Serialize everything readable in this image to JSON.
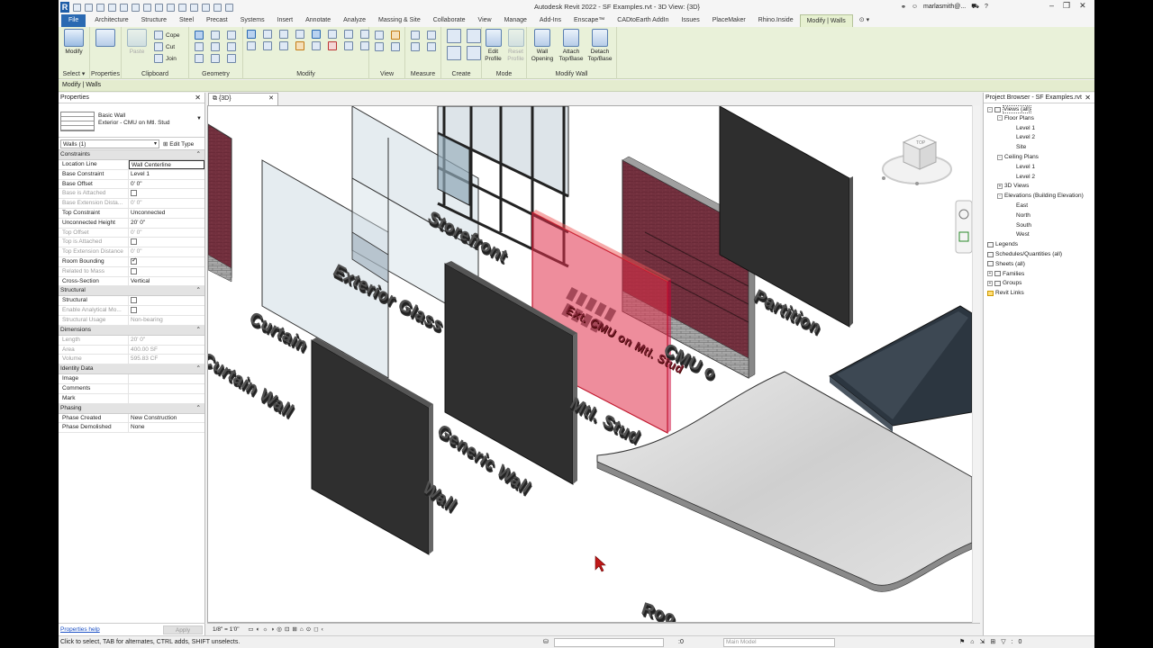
{
  "title_bar": {
    "title": "Autodesk Revit 2022 - SF Examples.rvt - 3D View: {3D}",
    "user": "marlasmith@...",
    "logo_letter": "R"
  },
  "ribbon_tabs": [
    "File",
    "Architecture",
    "Structure",
    "Steel",
    "Precast",
    "Systems",
    "Insert",
    "Annotate",
    "Analyze",
    "Massing & Site",
    "Collaborate",
    "View",
    "Manage",
    "Add-Ins",
    "Enscape™",
    "CADtoEarth AddIn",
    "Issues",
    "PlaceMaker",
    "Rhino.Inside",
    "Modify | Walls"
  ],
  "ribbon": {
    "modify_label": "Modify",
    "select_label": "Select ▾",
    "properties_label": "Properties",
    "paste_label": "Paste",
    "clipboard_label": "Clipboard",
    "cope_label": "Cope",
    "cut_label": "Cut",
    "join_label": "Join",
    "geometry_label": "Geometry",
    "modify_panel_label": "Modify",
    "view_label": "View",
    "measure_label": "Measure",
    "create_label": "Create",
    "edit_profile_label": "Edit Profile",
    "reset_profile_label": "Reset Profile",
    "mode_label": "Mode",
    "wall_opening_label": "Wall Opening",
    "attach_label": "Attach Top/Base",
    "detach_label": "Detach Top/Base",
    "modify_wall_label": "Modify Wall"
  },
  "context_bar": {
    "text": "Modify | Walls"
  },
  "properties": {
    "header": "Properties",
    "type_family": "Basic Wall",
    "type_name": "Exterior - CMU on Mtl. Stud",
    "instance_filter": "Walls (1)",
    "edit_type": "Edit Type",
    "groups": [
      {
        "name": "Constraints",
        "rows": [
          {
            "k": "Location Line",
            "v": "Wall Centerline",
            "boxed": true
          },
          {
            "k": "Base Constraint",
            "v": "Level 1"
          },
          {
            "k": "Base Offset",
            "v": "0'  0\""
          },
          {
            "k": "Base is Attached",
            "v": "",
            "dis": true,
            "cb": "off"
          },
          {
            "k": "Base Extension Dista...",
            "v": "0'  0\"",
            "dis": true
          },
          {
            "k": "Top Constraint",
            "v": "Unconnected"
          },
          {
            "k": "Unconnected Height",
            "v": "20'  0\""
          },
          {
            "k": "Top Offset",
            "v": "0'  0\"",
            "dis": true
          },
          {
            "k": "Top is Attached",
            "v": "",
            "dis": true,
            "cb": "off"
          },
          {
            "k": "Top Extension Distance",
            "v": "0'  0\"",
            "dis": true
          },
          {
            "k": "Room Bounding",
            "v": "",
            "cb": "on"
          },
          {
            "k": "Related to Mass",
            "v": "",
            "dis": true,
            "cb": "off"
          },
          {
            "k": "Cross-Section",
            "v": "Vertical"
          }
        ]
      },
      {
        "name": "Structural",
        "rows": [
          {
            "k": "Structural",
            "v": "",
            "cb": "off"
          },
          {
            "k": "Enable Analytical Mo...",
            "v": "",
            "dis": true,
            "cb": "off"
          },
          {
            "k": "Structural Usage",
            "v": "Non-bearing",
            "dis": true
          }
        ]
      },
      {
        "name": "Dimensions",
        "rows": [
          {
            "k": "Length",
            "v": "20'  0\"",
            "dis": true
          },
          {
            "k": "Area",
            "v": "400.00 SF",
            "dis": true
          },
          {
            "k": "Volume",
            "v": "595.83 CF",
            "dis": true
          }
        ]
      },
      {
        "name": "Identity Data",
        "rows": [
          {
            "k": "Image",
            "v": ""
          },
          {
            "k": "Comments",
            "v": ""
          },
          {
            "k": "Mark",
            "v": ""
          }
        ]
      },
      {
        "name": "Phasing",
        "rows": [
          {
            "k": "Phase Created",
            "v": "New Construction"
          },
          {
            "k": "Phase Demolished",
            "v": "None"
          }
        ]
      }
    ],
    "help_link": "Properties help",
    "apply": "Apply"
  },
  "view": {
    "tab_label": "{3D}",
    "scale": "1/8\" = 1'0\"",
    "labels": {
      "storefront": "Storefront",
      "exterior_glass": "Exterior Glass",
      "curtain": "Curtain",
      "curtain_wall": "Curtain Wall",
      "generic_wall": "Generic Wall",
      "wall": "Wall",
      "cmu": "CMU o",
      "partition": "Partition",
      "mtl_stud": "Mtl. Stud",
      "roof": "Roo",
      "red_text": "Ext. CMU on Mtl. Stud"
    }
  },
  "project_browser": {
    "header": "Project Browser - SF Examples.rvt",
    "tree": [
      {
        "label": "Views (all)",
        "level": 0,
        "pm": "-",
        "icon": true,
        "selected": true
      },
      {
        "label": "Floor Plans",
        "level": 1,
        "pm": "-"
      },
      {
        "label": "Level 1",
        "level": 2
      },
      {
        "label": "Level 2",
        "level": 2
      },
      {
        "label": "Site",
        "level": 2
      },
      {
        "label": "Ceiling Plans",
        "level": 1,
        "pm": "-"
      },
      {
        "label": "Level 1",
        "level": 2
      },
      {
        "label": "Level 2",
        "level": 2
      },
      {
        "label": "3D Views",
        "level": 1,
        "pm": "+"
      },
      {
        "label": "Elevations (Building Elevation)",
        "level": 1,
        "pm": "-"
      },
      {
        "label": "East",
        "level": 2
      },
      {
        "label": "North",
        "level": 2
      },
      {
        "label": "South",
        "level": 2
      },
      {
        "label": "West",
        "level": 2
      },
      {
        "label": "Legends",
        "level": 0,
        "icon": true
      },
      {
        "label": "Schedules/Quantities (all)",
        "level": 0,
        "icon": true
      },
      {
        "label": "Sheets (all)",
        "level": 0,
        "icon": true
      },
      {
        "label": "Families",
        "level": 0,
        "pm": "+",
        "icon": true
      },
      {
        "label": "Groups",
        "level": 0,
        "pm": "+",
        "icon": true
      },
      {
        "label": "Revit Links",
        "level": 0,
        "icon": "link"
      }
    ]
  },
  "status_bar": {
    "message": "Click to select, TAB for alternates, CTRL adds, SHIFT unselects.",
    "zero": ":0",
    "model": "Main Model"
  },
  "colors": {
    "accent": "#2a69b2",
    "ribbon_bg": "#e9f1d9",
    "selected_wall": "#e0304a"
  }
}
